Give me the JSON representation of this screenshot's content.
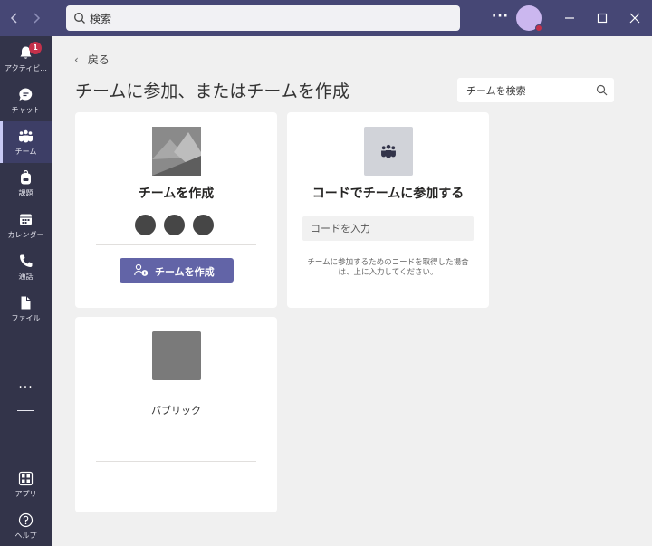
{
  "titlebar": {
    "search_placeholder": "検索",
    "more_label": "···"
  },
  "rail": {
    "items": [
      {
        "label": "アクティビ...",
        "icon": "bell-icon",
        "badge": "1"
      },
      {
        "label": "チャット",
        "icon": "chat-icon"
      },
      {
        "label": "チーム",
        "icon": "teams-icon",
        "active": true
      },
      {
        "label": "課題",
        "icon": "backpack-icon"
      },
      {
        "label": "カレンダー",
        "icon": "calendar-icon"
      },
      {
        "label": "通話",
        "icon": "phone-icon"
      },
      {
        "label": "ファイル",
        "icon": "file-icon"
      }
    ],
    "more_label": "···",
    "apps_label": "アプリ",
    "help_label": "ヘルプ"
  },
  "main": {
    "back_label": "戻る",
    "title": "チームに参加、またはチームを作成",
    "team_search_placeholder": "チームを検索",
    "create_card": {
      "title": "チームを作成",
      "button_label": "チームを作成"
    },
    "code_card": {
      "title": "コードでチームに参加する",
      "input_placeholder": "コードを入力",
      "help_text": "チームに参加するためのコードを取得した場合は、上に入力してください。"
    },
    "public_card": {
      "label": "パブリック"
    }
  },
  "colors": {
    "titlebar": "#464775",
    "rail": "#33344a",
    "accent": "#6264a7",
    "badge": "#c4314b"
  }
}
